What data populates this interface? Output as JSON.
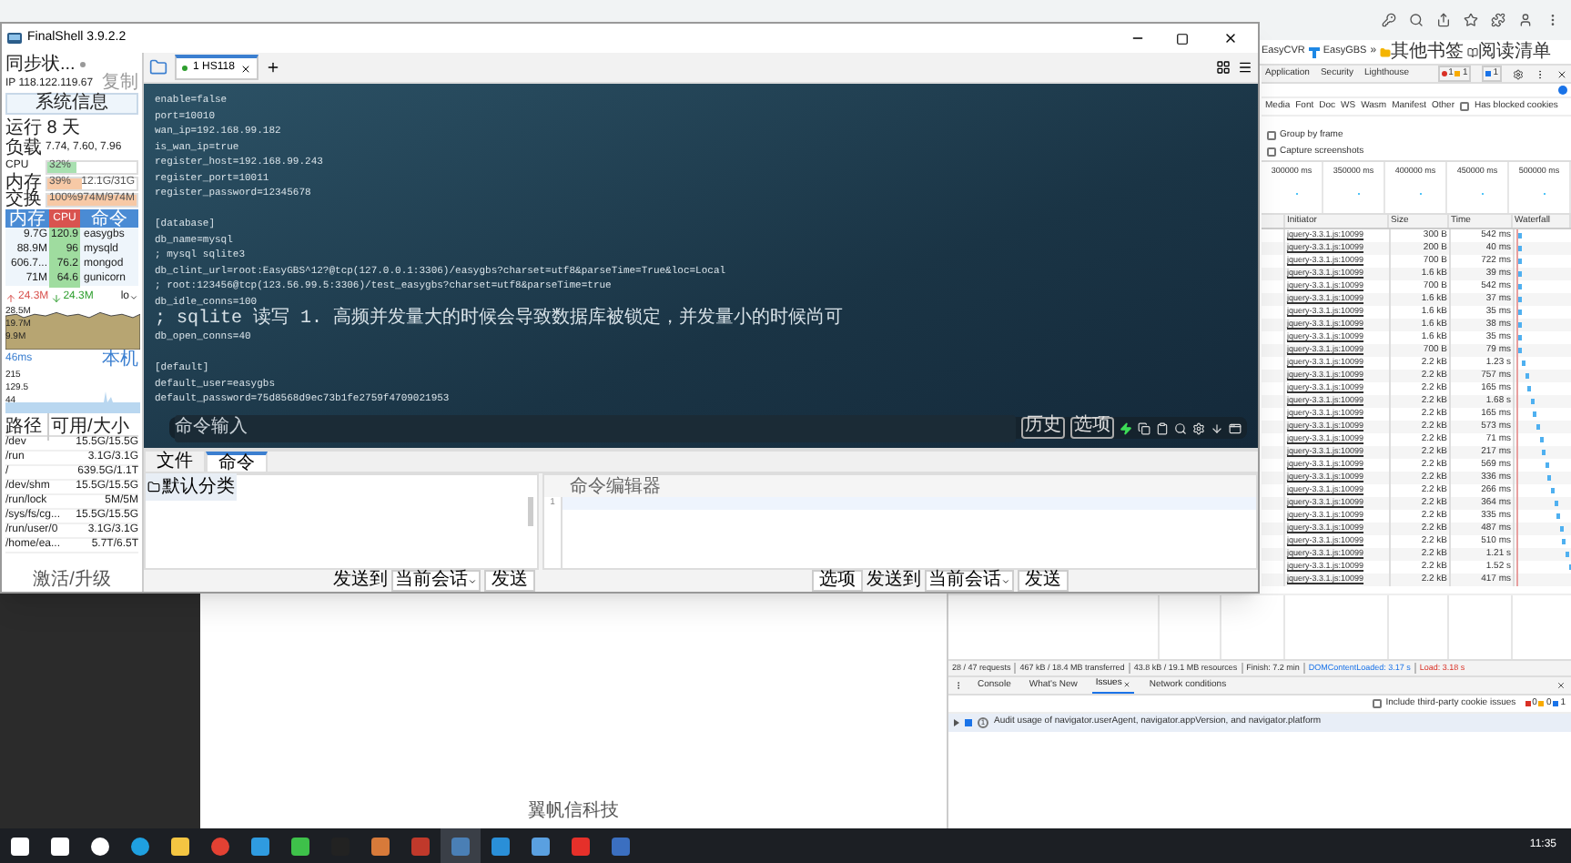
{
  "browser": {
    "bookmarks": [
      {
        "label": "EasyCVR",
        "kind": "plain"
      },
      {
        "label": "EasyGBS",
        "kind": "logo"
      }
    ],
    "more": "»",
    "other_bookmarks": "其他书签",
    "reading_list": "阅读清单"
  },
  "page": {
    "footer": "翼帆信科技"
  },
  "devtools": {
    "tabs": [
      {
        "label": "Application",
        "selected": false
      },
      {
        "label": "Security",
        "selected": false
      },
      {
        "label": "Lighthouse",
        "selected": false
      }
    ],
    "badges": {
      "errors": "1",
      "warnings": "1",
      "info": "1"
    },
    "type_filters": [
      "Media",
      "Font",
      "Doc",
      "WS",
      "Wasm",
      "Manifest",
      "Other"
    ],
    "blocked_cookies": {
      "label": "Has blocked cookies",
      "checked": false
    },
    "options": [
      {
        "label": "Group by frame",
        "checked": false
      },
      {
        "label": "Capture screenshots",
        "checked": false
      }
    ],
    "overview_ticks": [
      "300000 ms",
      "350000 ms",
      "400000 ms",
      "450000 ms",
      "500000 ms"
    ],
    "columns": [
      "Initiator",
      "Size",
      "Time",
      "Waterfall"
    ],
    "rows": [
      {
        "initiator": "jquery-3.3.1.js:10099",
        "size": "300 B",
        "time": "542 ms"
      },
      {
        "initiator": "jquery-3.3.1.js:10099",
        "size": "200 B",
        "time": "40 ms"
      },
      {
        "initiator": "jquery-3.3.1.js:10099",
        "size": "700 B",
        "time": "722 ms"
      },
      {
        "initiator": "jquery-3.3.1.js:10099",
        "size": "1.6 kB",
        "time": "39 ms"
      },
      {
        "initiator": "jquery-3.3.1.js:10099",
        "size": "700 B",
        "time": "542 ms"
      },
      {
        "initiator": "jquery-3.3.1.js:10099",
        "size": "1.6 kB",
        "time": "37 ms"
      },
      {
        "initiator": "jquery-3.3.1.js:10099",
        "size": "1.6 kB",
        "time": "35 ms"
      },
      {
        "initiator": "jquery-3.3.1.js:10099",
        "size": "1.6 kB",
        "time": "38 ms"
      },
      {
        "initiator": "jquery-3.3.1.js:10099",
        "size": "1.6 kB",
        "time": "35 ms"
      },
      {
        "initiator": "jquery-3.3.1.js:10099",
        "size": "700 B",
        "time": "79 ms"
      },
      {
        "initiator": "jquery-3.3.1.js:10099",
        "size": "2.2 kB",
        "time": "1.23 s"
      },
      {
        "initiator": "jquery-3.3.1.js:10099",
        "size": "2.2 kB",
        "time": "757 ms"
      },
      {
        "initiator": "jquery-3.3.1.js:10099",
        "size": "2.2 kB",
        "time": "165 ms"
      },
      {
        "initiator": "jquery-3.3.1.js:10099",
        "size": "2.2 kB",
        "time": "1.68 s"
      },
      {
        "initiator": "jquery-3.3.1.js:10099",
        "size": "2.2 kB",
        "time": "165 ms"
      },
      {
        "initiator": "jquery-3.3.1.js:10099",
        "size": "2.2 kB",
        "time": "573 ms"
      },
      {
        "initiator": "jquery-3.3.1.js:10099",
        "size": "2.2 kB",
        "time": "71 ms"
      },
      {
        "initiator": "jquery-3.3.1.js:10099",
        "size": "2.2 kB",
        "time": "217 ms"
      },
      {
        "initiator": "jquery-3.3.1.js:10099",
        "size": "2.2 kB",
        "time": "569 ms"
      },
      {
        "initiator": "jquery-3.3.1.js:10099",
        "size": "2.2 kB",
        "time": "336 ms"
      },
      {
        "initiator": "jquery-3.3.1.js:10099",
        "size": "2.2 kB",
        "time": "266 ms"
      },
      {
        "initiator": "jquery-3.3.1.js:10099",
        "size": "2.2 kB",
        "time": "364 ms"
      },
      {
        "initiator": "jquery-3.3.1.js:10099",
        "size": "2.2 kB",
        "time": "335 ms"
      },
      {
        "initiator": "jquery-3.3.1.js:10099",
        "size": "2.2 kB",
        "time": "487 ms"
      },
      {
        "initiator": "jquery-3.3.1.js:10099",
        "size": "2.2 kB",
        "time": "510 ms"
      },
      {
        "initiator": "jquery-3.3.1.js:10099",
        "size": "2.2 kB",
        "time": "1.21 s"
      },
      {
        "initiator": "jquery-3.3.1.js:10099",
        "size": "2.2 kB",
        "time": "1.52 s"
      },
      {
        "initiator": "jquery-3.3.1.js:10099",
        "size": "2.2 kB",
        "time": "417 ms"
      }
    ],
    "summary": {
      "requests": "28 / 47 requests",
      "transferred": "467 kB / 18.4 MB transferred",
      "resources": "43.8 kB / 19.1 MB resources",
      "finish": "Finish: 7.2 min",
      "dom_content_loaded": "DOMContentLoaded: 3.17 s",
      "load": "Load: 3.18 s"
    },
    "drawer_tabs": [
      {
        "label": "Console",
        "selected": false
      },
      {
        "label": "What's New",
        "selected": false
      },
      {
        "label": "Issues",
        "selected": true
      },
      {
        "label": "Network conditions",
        "selected": false
      }
    ],
    "third_party": {
      "label": "Include third-party cookie issues",
      "checked": false
    },
    "issue_counts": {
      "errors": "0",
      "warnings": "0",
      "info": "1"
    },
    "issue": {
      "count": "1",
      "text": "Audit usage of navigator.userAgent, navigator.appVersion, and navigator.platform"
    }
  },
  "finalshell": {
    "title": "FinalShell 3.9.2.2",
    "sync": "同步状...",
    "ip": "IP 118.122.119.67",
    "copy": "复制",
    "sysinfo_button": "系统信息",
    "uptime": "运行 8 天",
    "load_label": "负载",
    "load": "7.74, 7.60, 7.96",
    "meters": [
      {
        "label": "CPU",
        "reading": "32%",
        "level": 0.32,
        "color": "#a8e0b0"
      },
      {
        "label": "内存",
        "reading": "39%",
        "detail": "12.1G/31G",
        "level": 0.39,
        "color": "#f7c9a6"
      },
      {
        "label": "交换",
        "reading": "100%",
        "detail": "974M/974M",
        "level": 1,
        "color": "#f7c9a6"
      }
    ],
    "process_columns": [
      {
        "label": "内存",
        "selected": false
      },
      {
        "label": "CPU",
        "selected": true
      },
      {
        "label": "命令",
        "selected": false
      }
    ],
    "processes": [
      {
        "memory": "9.7G",
        "cpu": "120.9",
        "command": "easygbs"
      },
      {
        "memory": "88.9M",
        "cpu": "96",
        "command": "mysqld"
      },
      {
        "memory": "606.7...",
        "cpu": "76.2",
        "command": "mongod"
      },
      {
        "memory": "71M",
        "cpu": "64.6",
        "command": "gunicorn"
      }
    ],
    "network": {
      "up": "24.3M",
      "down": "24.3M",
      "interface": "lo",
      "ticks": [
        "28.5M",
        "19.7M",
        "9.9M"
      ]
    },
    "ping": {
      "latency": "46ms",
      "host": "本机",
      "ticks": [
        "215",
        "129.5",
        "44"
      ]
    },
    "disk_columns": [
      "路径",
      "可用/大小"
    ],
    "disks": [
      {
        "path": "/dev",
        "usage": "15.5G/15.5G"
      },
      {
        "path": "/run",
        "usage": "3.1G/3.1G"
      },
      {
        "path": "/",
        "usage": "639.5G/1.1T"
      },
      {
        "path": "/dev/shm",
        "usage": "15.5G/15.5G"
      },
      {
        "path": "/run/lock",
        "usage": "5M/5M"
      },
      {
        "path": "/sys/fs/cg...",
        "usage": "15.5G/15.5G"
      },
      {
        "path": "/run/user/0",
        "usage": "3.1G/3.1G"
      },
      {
        "path": "/home/ea...",
        "usage": "5.7T/6.5T"
      }
    ],
    "footer": "激活/升级",
    "session_tabs": [
      {
        "label": "1 HS118",
        "selected": true
      }
    ],
    "terminal_blocks": [
      [
        "enable=false",
        "port=10010",
        "wan_ip=192.168.99.182",
        "is_wan_ip=true",
        "register_host=192.168.99.243",
        "register_port=10011",
        "register_password=12345678"
      ],
      [
        "[database]",
        "db_name=mysql",
        "; mysql sqlite3",
        "db_clint_url=root:EasyGBS^12?@tcp(127.0.0.1:3306)/easygbs?charset=utf8&parseTime=True&loc=Local",
        "; root:123456@tcp(123.56.99.5:3306)/test_easygbs?charset=utf8&parseTime=true",
        "db_idle_conns=100",
        "; sqlite 读写 1. 高频并发量大的时候会导致数据库被锁定，并发量小的时候尚可",
        "db_open_conns=40"
      ],
      [
        "[default]",
        "default_user=easygbs",
        "default_password=75d8568d9ec73b1fe2759f4709021953"
      ]
    ],
    "command_input": {
      "placeholder": "命令输入"
    },
    "history_button": "历史",
    "options_button": "选项",
    "panel_tabs": [
      {
        "label": "文件",
        "selected": false
      },
      {
        "label": "命令",
        "selected": true
      }
    ],
    "category": "默认分类",
    "editor_title": "命令编辑器",
    "line_numbers": [
      "1"
    ],
    "left_bar": {
      "send_to": "发送到",
      "target": "当前会话",
      "send": "发送"
    },
    "right_bar": {
      "options": "选项",
      "send_to": "发送到",
      "target": "当前会话",
      "send": "发送"
    }
  },
  "taskbar": {
    "clock": "11:35"
  }
}
